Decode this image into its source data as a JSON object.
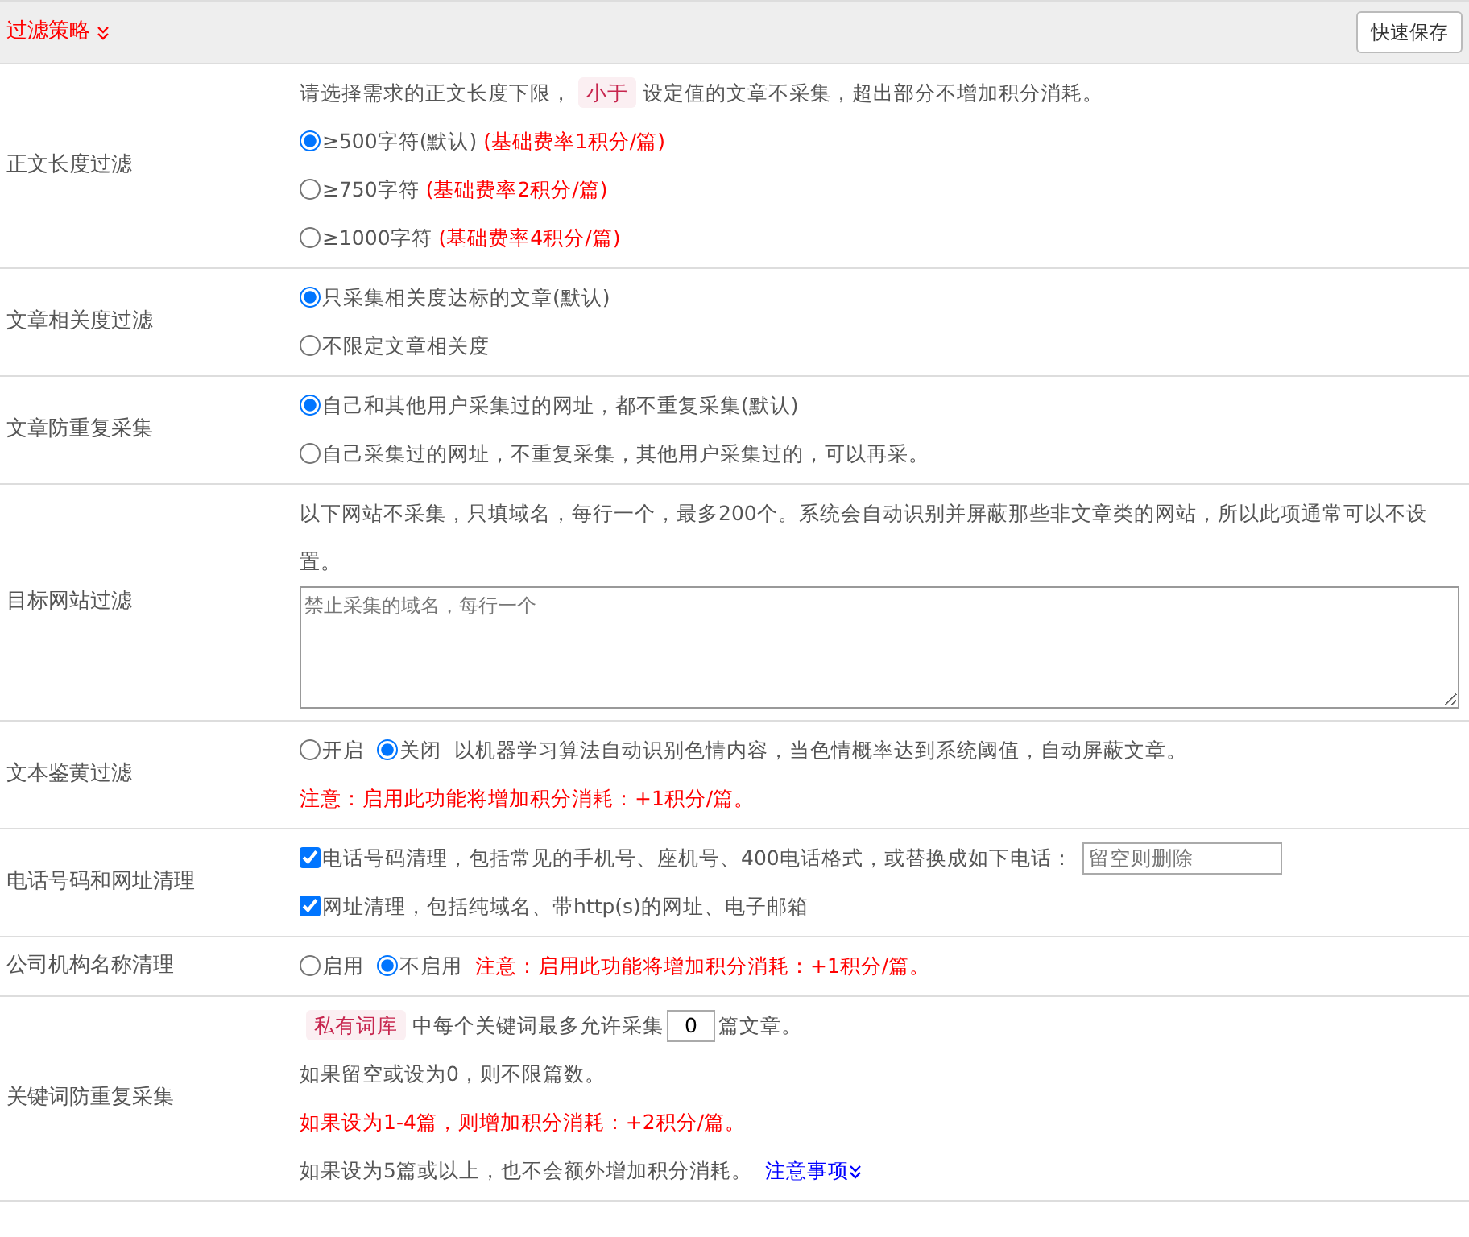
{
  "header": {
    "title": "过滤策略",
    "save_button": "快速保存"
  },
  "rows": [
    {
      "label": "正文长度过滤",
      "items": [
        {
          "kind": "line",
          "warning": false,
          "segments": [
            {
              "kind": "plain",
              "text": "请选择需求的正文长度下限，"
            },
            {
              "kind": "tag",
              "text": "小于"
            },
            {
              "kind": "plain",
              "text": "设定值的文章不采集，超出部分不增加积分消耗。"
            }
          ]
        },
        {
          "kind": "radios",
          "inline": false,
          "options": [
            {
              "label": "≥500字符(默认)",
              "note": "(基础费率1积分/篇)",
              "selected": true
            },
            {
              "label": "≥750字符",
              "note": "(基础费率2积分/篇)",
              "selected": false
            },
            {
              "label": "≥1000字符",
              "note": "(基础费率4积分/篇)",
              "selected": false
            }
          ]
        }
      ]
    },
    {
      "label": "文章相关度过滤",
      "items": [
        {
          "kind": "radios",
          "inline": false,
          "options": [
            {
              "label": "只采集相关度达标的文章(默认)",
              "selected": true
            },
            {
              "label": "不限定文章相关度",
              "selected": false
            }
          ]
        }
      ]
    },
    {
      "label": "文章防重复采集",
      "items": [
        {
          "kind": "radios",
          "inline": false,
          "options": [
            {
              "label": "自己和其他用户采集过的网址，都不重复采集(默认)",
              "selected": true
            },
            {
              "label": "自己采集过的网址，不重复采集，其他用户采集过的，可以再采。",
              "selected": false
            }
          ]
        }
      ]
    },
    {
      "label": "目标网站过滤",
      "items": [
        {
          "kind": "line",
          "warning": false,
          "segments": [
            {
              "kind": "plain",
              "text": "以下网站不采集，只填域名，每行一个，最多200个。系统会自动识别并屏蔽那些非文章类的网站，所以此项通常可以不设置。"
            }
          ]
        },
        {
          "kind": "textarea",
          "placeholder": "禁止采集的域名，每行一个"
        }
      ]
    },
    {
      "label": "文本鉴黄过滤",
      "items": [
        {
          "kind": "radios",
          "inline": true,
          "options": [
            {
              "label": "开启",
              "selected": false
            },
            {
              "label": "关闭",
              "selected": true
            }
          ],
          "after": {
            "text": "以机器学习算法自动识别色情内容，当色情概率达到系统阈值，自动屏蔽文章。",
            "warning": false
          }
        },
        {
          "kind": "line",
          "warning": true,
          "segments": [
            {
              "kind": "plain",
              "text": "注意：启用此功能将增加积分消耗：+1积分/篇。"
            }
          ]
        }
      ]
    },
    {
      "label": "电话号码和网址清理",
      "items": [
        {
          "kind": "checkbox",
          "label": "电话号码清理，包括常见的手机号、座机号、400电话格式，或替换成如下电话：",
          "checked": true,
          "field": {
            "placeholder": "留空则删除"
          }
        },
        {
          "kind": "checkbox",
          "label": "网址清理，包括纯域名、带http(s)的网址、电子邮箱",
          "checked": true
        }
      ]
    },
    {
      "label": "公司机构名称清理",
      "items": [
        {
          "kind": "radios",
          "inline": true,
          "options": [
            {
              "label": "启用",
              "selected": false
            },
            {
              "label": "不启用",
              "selected": true
            }
          ],
          "after": {
            "text": "注意：启用此功能将增加积分消耗：+1积分/篇。",
            "warning": true
          }
        }
      ]
    },
    {
      "label": "关键词防重复采集",
      "items": [
        {
          "kind": "line",
          "warning": false,
          "segments": [
            {
              "kind": "tag",
              "text": "私有词库"
            },
            {
              "kind": "plain",
              "text": "中每个关键词最多允许采集"
            },
            {
              "kind": "field",
              "text": "0"
            },
            {
              "kind": "plain",
              "text": "篇文章。"
            }
          ]
        },
        {
          "kind": "line",
          "warning": false,
          "segments": [
            {
              "kind": "plain",
              "text": "如果留空或设为0，则不限篇数。"
            }
          ]
        },
        {
          "kind": "line",
          "warning": true,
          "segments": [
            {
              "kind": "plain",
              "text": "如果设为1-4篇，则增加积分消耗：+2积分/篇。"
            }
          ]
        },
        {
          "kind": "line",
          "warning": false,
          "segments": [
            {
              "kind": "plain",
              "text": "如果设为5篇或以上，也不会额外增加积分消耗。"
            },
            {
              "kind": "link",
              "text": "注意事项"
            }
          ]
        }
      ]
    }
  ]
}
